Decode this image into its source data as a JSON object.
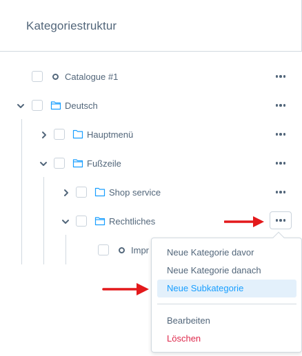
{
  "panel": {
    "title": "Kategoriestruktur"
  },
  "tree": {
    "items": [
      {
        "label": "Catalogue #1",
        "icon": "circle-dot-icon",
        "expanded": null
      },
      {
        "label": "Deutsch",
        "icon": "folder-icon",
        "expanded": true
      },
      {
        "label": "Hauptmenü",
        "icon": "folder-icon",
        "expanded": false
      },
      {
        "label": "Fußzeile",
        "icon": "folder-icon",
        "expanded": true
      },
      {
        "label": "Shop service",
        "icon": "folder-icon",
        "expanded": false
      },
      {
        "label": "Rechtliches",
        "icon": "folder-icon",
        "expanded": true
      },
      {
        "label": "Impr",
        "icon": "circle-dot-icon",
        "expanded": null
      }
    ]
  },
  "context_menu": {
    "items": [
      {
        "label": "Neue Kategorie davor"
      },
      {
        "label": "Neue Kategorie danach"
      },
      {
        "label": "Neue Subkategorie",
        "highlighted": true
      },
      {
        "label": "Bearbeiten"
      },
      {
        "label": "Löschen",
        "danger": true
      }
    ]
  },
  "colors": {
    "text": "#52667a",
    "accent": "#189eff",
    "highlight_bg": "#e3f0fb",
    "danger": "#de294c",
    "annotation_arrow": "#e3191b",
    "border": "#d1d9e0"
  }
}
